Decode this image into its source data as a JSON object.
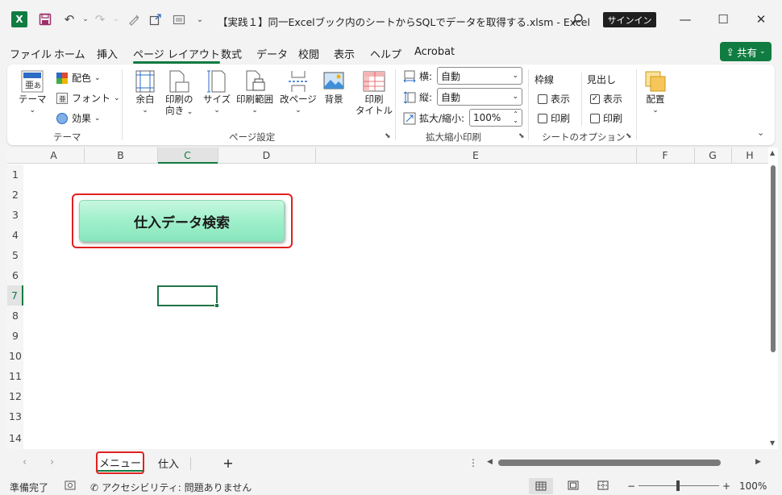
{
  "window": {
    "title": "【実践１】同一Excelブック内のシートからSQLでデータを取得する.xlsm  -  Excel",
    "signin": "サインイン",
    "minimize": "—",
    "maximize": "☐",
    "close": "✕"
  },
  "menu": {
    "items": [
      "ファイル",
      "ホーム",
      "挿入",
      "ページ レイアウト",
      "数式",
      "データ",
      "校閲",
      "表示",
      "ヘルプ",
      "Acrobat"
    ],
    "active_index": 3,
    "share": "共有"
  },
  "ribbon": {
    "themes": {
      "theme": "テーマ",
      "colors": "配色",
      "fonts": "フォント",
      "effects": "効果",
      "group": "テーマ"
    },
    "page_setup": {
      "margins": "余白",
      "orientation_1": "印刷の",
      "orientation_2": "向き",
      "size": "サイズ",
      "print_area": "印刷範囲",
      "breaks": "改ページ",
      "background": "背景",
      "titles_1": "印刷",
      "titles_2": "タイトル",
      "group": "ページ設定"
    },
    "scale": {
      "width_label": "横:",
      "width_value": "自動",
      "height_label": "縦:",
      "height_value": "自動",
      "scale_label": "拡大/縮小:",
      "scale_value": "100%",
      "group": "拡大縮小印刷"
    },
    "sheet_options": {
      "gridlines": "枠線",
      "headings": "見出し",
      "view": "表示",
      "print": "印刷",
      "group": "シートのオプション"
    },
    "arrange": {
      "arrange": "配置"
    }
  },
  "sheet": {
    "columns": [
      "A",
      "B",
      "C",
      "D",
      "E",
      "F",
      "G",
      "H"
    ],
    "rows": [
      "1",
      "2",
      "3",
      "4",
      "5",
      "6",
      "7",
      "8",
      "9",
      "10",
      "11",
      "12",
      "13",
      "14"
    ],
    "selected_column": "C",
    "selected_row": "7",
    "macro_button": "仕入データ検索"
  },
  "tabs": {
    "items": [
      "メニュー",
      "仕入"
    ],
    "active_index": 0,
    "add": "+"
  },
  "status": {
    "ready": "準備完了",
    "accessibility": "アクセシビリティ: 問題ありません",
    "zoom": "100%"
  },
  "colors": {
    "accent": "#107c41",
    "highlight": "#e02020",
    "button": "#a2f0cc"
  }
}
